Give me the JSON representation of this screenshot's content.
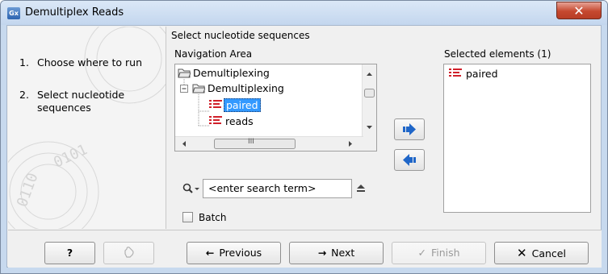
{
  "window": {
    "app_icon_text": "Gx",
    "title": "Demultiplex Reads",
    "close_glyph": "✕"
  },
  "steps": [
    {
      "number": "1.",
      "label": "Choose where to run"
    },
    {
      "number": "2.",
      "label": "Select nucleotide sequences"
    }
  ],
  "content": {
    "heading": "Select nucleotide sequences",
    "nav_label": "Navigation Area",
    "selected_label": "Selected elements (1)",
    "tree": [
      {
        "label": "Demultiplexing",
        "icon": "folder-icon"
      },
      {
        "label": "Demultiplexing",
        "icon": "folder-icon"
      },
      {
        "label": "paired",
        "icon": "sequence-list-icon",
        "selected": true
      },
      {
        "label": "reads",
        "icon": "sequence-list-icon"
      }
    ],
    "selected_items": [
      {
        "label": "paired",
        "icon": "sequence-list-icon"
      }
    ],
    "search_placeholder": "<enter search term>",
    "batch_label": "Batch",
    "scroll_thumb_glyph": "III"
  },
  "buttons": {
    "help": "?",
    "previous": "Previous",
    "next": "Next",
    "finish": "Finish",
    "cancel": "Cancel"
  },
  "colors": {
    "accent": "#3399ff",
    "arrow_blue": "#1f66c8",
    "sequence_icon_red": "#d0202a",
    "close_red": "#c5482f"
  }
}
